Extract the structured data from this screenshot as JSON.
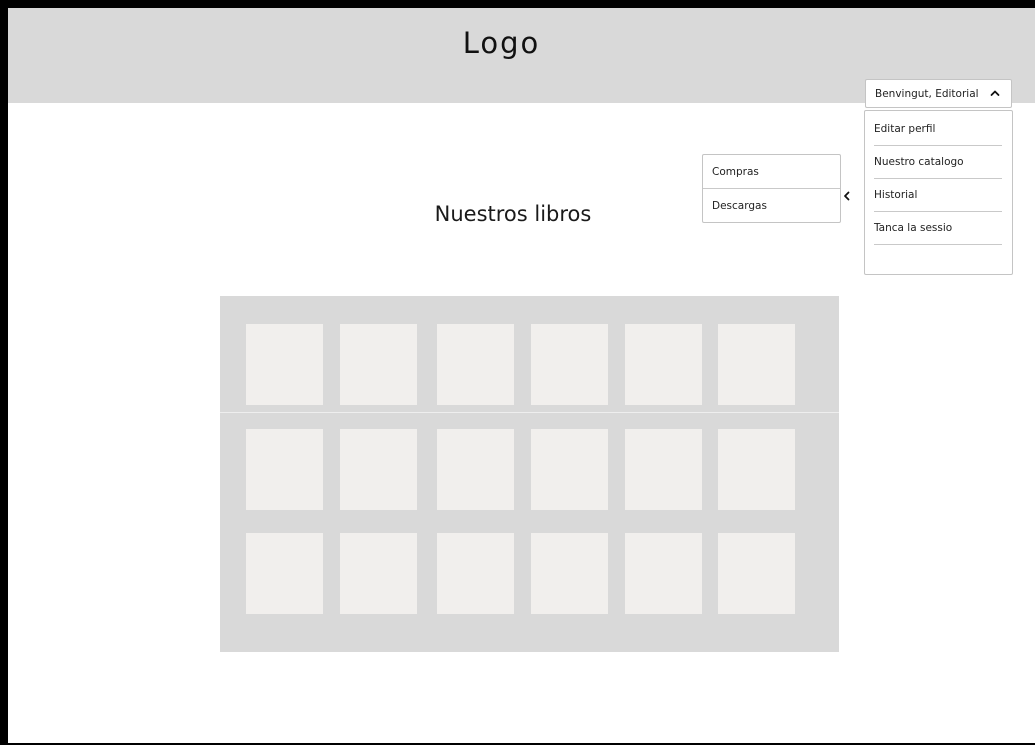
{
  "header": {
    "logo_text": "Logo"
  },
  "main": {
    "title": "Nuestros libros"
  },
  "user_menu": {
    "greeting": "Benvingut, Editorial",
    "toggle_icon": "chevron-up-icon",
    "items": [
      {
        "label": "Editar perfil"
      },
      {
        "label": "Nuestro catalogo"
      },
      {
        "label": "Historial"
      },
      {
        "label": "Tanca la sessio"
      }
    ]
  },
  "side_panel": {
    "collapse_icon": "chevron-left-icon",
    "items": [
      {
        "label": "Compras"
      },
      {
        "label": "Descargas"
      }
    ]
  },
  "book_grid": {
    "rows": 3,
    "columns": 6,
    "book_count": 18
  },
  "colors": {
    "header_bg": "#d9d9d9",
    "grid_bg": "#d9d9d9",
    "card_bg": "#f1efed",
    "frame_border": "#000000"
  }
}
